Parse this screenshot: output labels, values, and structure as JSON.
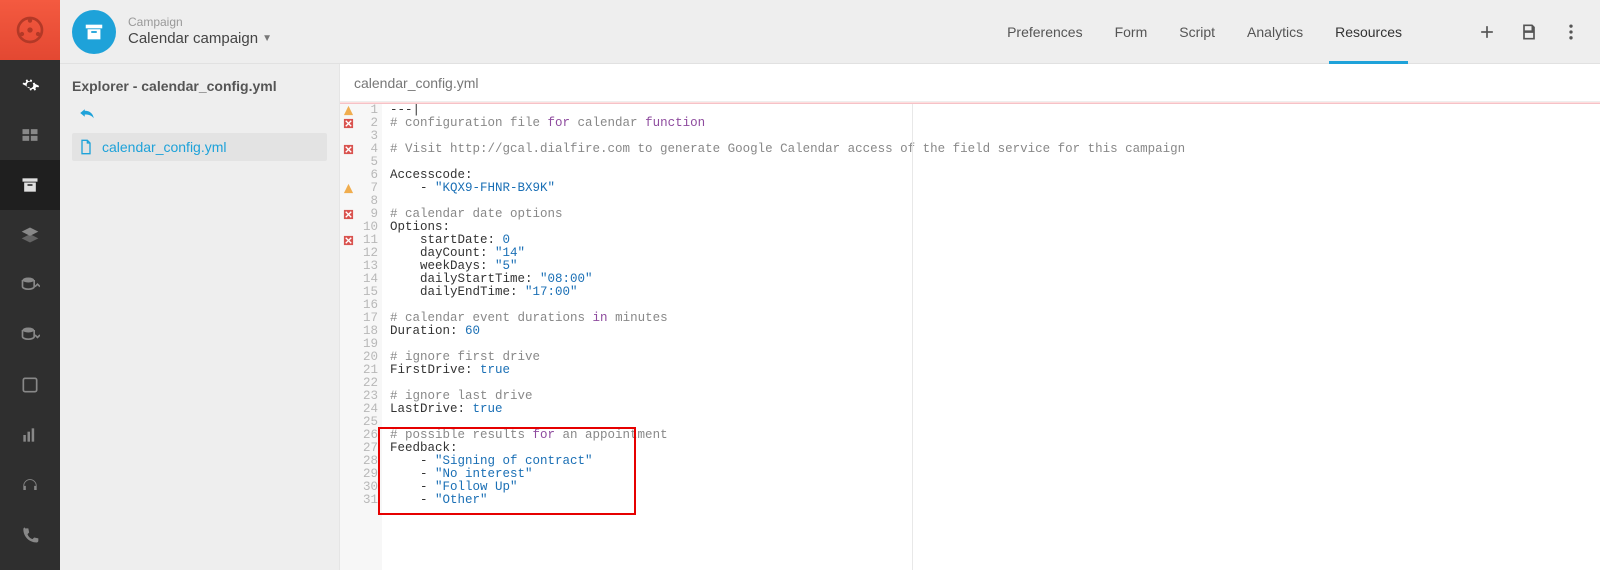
{
  "header": {
    "breadcrumb_label": "Campaign",
    "campaign_name": "Calendar campaign",
    "tabs": [
      "Preferences",
      "Form",
      "Script",
      "Analytics",
      "Resources"
    ],
    "active_tab": 4
  },
  "explorer": {
    "title": "Explorer - calendar_config.yml",
    "file": "calendar_config.yml"
  },
  "editor": {
    "filename": "calendar_config.yml",
    "gutter_status": {
      "1": "warn",
      "2": "err",
      "4": "err",
      "7": "warn",
      "9": "err",
      "11": "err"
    },
    "lines": [
      {
        "n": 1,
        "segs": [
          [
            "---|",
            "p"
          ]
        ]
      },
      {
        "n": 2,
        "segs": [
          [
            "# configuration file ",
            "c"
          ],
          [
            "for",
            "k"
          ],
          [
            " calendar ",
            "c"
          ],
          [
            "function",
            "k"
          ]
        ]
      },
      {
        "n": 3,
        "segs": [
          [
            "",
            "p"
          ]
        ]
      },
      {
        "n": 4,
        "segs": [
          [
            "# Visit http:",
            "c"
          ],
          [
            "//gcal.dialfire.com to generate Google Calendar access of the field service for this campaign",
            "url"
          ]
        ]
      },
      {
        "n": 5,
        "segs": [
          [
            "",
            "p"
          ]
        ]
      },
      {
        "n": 6,
        "segs": [
          [
            "Accesscode:",
            "p"
          ]
        ]
      },
      {
        "n": 7,
        "segs": [
          [
            "    - ",
            "p"
          ],
          [
            "\"KQX9-FHNR-BX9K\"",
            "s"
          ]
        ]
      },
      {
        "n": 8,
        "segs": [
          [
            "",
            "p"
          ]
        ]
      },
      {
        "n": 9,
        "segs": [
          [
            "# calendar date options",
            "c"
          ]
        ]
      },
      {
        "n": 10,
        "segs": [
          [
            "Options:",
            "p"
          ]
        ]
      },
      {
        "n": 11,
        "segs": [
          [
            "    startDate: ",
            "p"
          ],
          [
            "0",
            "n"
          ]
        ]
      },
      {
        "n": 12,
        "segs": [
          [
            "    dayCount: ",
            "p"
          ],
          [
            "\"14\"",
            "s"
          ]
        ]
      },
      {
        "n": 13,
        "segs": [
          [
            "    weekDays: ",
            "p"
          ],
          [
            "\"5\"",
            "s"
          ]
        ]
      },
      {
        "n": 14,
        "segs": [
          [
            "    dailyStartTime: ",
            "p"
          ],
          [
            "\"08:00\"",
            "s"
          ]
        ]
      },
      {
        "n": 15,
        "segs": [
          [
            "    dailyEndTime: ",
            "p"
          ],
          [
            "\"17:00\"",
            "s"
          ]
        ]
      },
      {
        "n": 16,
        "segs": [
          [
            "",
            "p"
          ]
        ]
      },
      {
        "n": 17,
        "segs": [
          [
            "# calendar event durations ",
            "c"
          ],
          [
            "in",
            "k"
          ],
          [
            " minutes",
            "c"
          ]
        ]
      },
      {
        "n": 18,
        "segs": [
          [
            "Duration: ",
            "p"
          ],
          [
            "60",
            "n"
          ]
        ]
      },
      {
        "n": 19,
        "segs": [
          [
            "",
            "p"
          ]
        ]
      },
      {
        "n": 20,
        "segs": [
          [
            "# ignore first drive",
            "c"
          ]
        ]
      },
      {
        "n": 21,
        "segs": [
          [
            "FirstDrive: ",
            "p"
          ],
          [
            "true",
            "b"
          ]
        ]
      },
      {
        "n": 22,
        "segs": [
          [
            "",
            "p"
          ]
        ]
      },
      {
        "n": 23,
        "segs": [
          [
            "# ignore last drive",
            "c"
          ]
        ]
      },
      {
        "n": 24,
        "segs": [
          [
            "LastDrive: ",
            "p"
          ],
          [
            "true",
            "b"
          ]
        ]
      },
      {
        "n": 25,
        "segs": [
          [
            "",
            "p"
          ]
        ]
      },
      {
        "n": 26,
        "segs": [
          [
            "# possible results ",
            "c"
          ],
          [
            "for",
            "k"
          ],
          [
            " an appointment",
            "c"
          ]
        ]
      },
      {
        "n": 27,
        "segs": [
          [
            "Feedback:",
            "p"
          ]
        ]
      },
      {
        "n": 28,
        "segs": [
          [
            "    - ",
            "p"
          ],
          [
            "\"Signing of contract\"",
            "s"
          ]
        ]
      },
      {
        "n": 29,
        "segs": [
          [
            "    - ",
            "p"
          ],
          [
            "\"No interest\"",
            "s"
          ]
        ]
      },
      {
        "n": 30,
        "segs": [
          [
            "    - ",
            "p"
          ],
          [
            "\"Follow Up\"",
            "s"
          ]
        ]
      },
      {
        "n": 31,
        "segs": [
          [
            "    - ",
            "p"
          ],
          [
            "\"Other\"",
            "s"
          ]
        ]
      }
    ],
    "highlight": {
      "from": 26,
      "to": 31
    }
  }
}
